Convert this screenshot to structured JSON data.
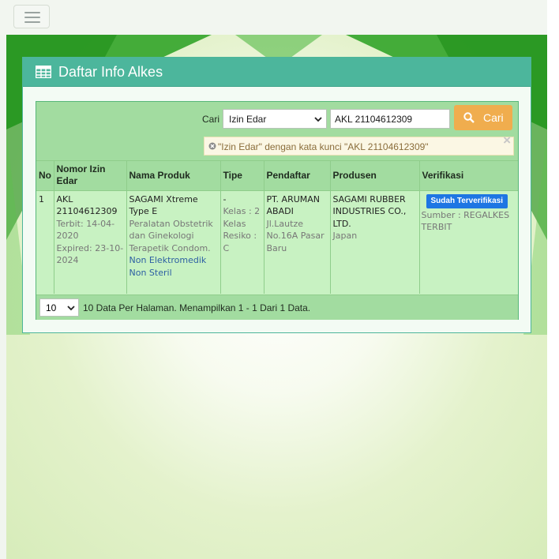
{
  "nav": {
    "menu_icon": "hamburger-icon"
  },
  "panel": {
    "title": "Daftar Info Alkes",
    "title_icon": "table-icon"
  },
  "search": {
    "label": "Cari",
    "field_selected": "Izin Edar",
    "query_value": "AKL 21104612309",
    "button_label": "Cari",
    "button_icon": "search-icon"
  },
  "alert": {
    "text": "\"Izin Edar\" dengan kata kunci \"AKL 21104612309\"",
    "close": "×"
  },
  "table": {
    "headers": [
      "No",
      "Nomor Izin Edar",
      "Nama Produk",
      "Tipe",
      "Pendaftar",
      "Produsen",
      "Verifikasi"
    ],
    "rows": [
      {
        "no": "1",
        "nomor": "AKL 21104612309",
        "terbit": "Terbit: 14-04-2020",
        "expired": "Expired: 23-10-2024",
        "nama": "SAGAMI Xtreme Type E",
        "kategori": "Peralatan Obstetrik dan Ginekologi Terapetik Condom.",
        "jenis": "Non Elektromedik Non Steril",
        "tipe": "-",
        "kelas": "Kelas : 2",
        "kelas_resiko": "Kelas Resiko : C",
        "pendaftar": "PT. ARUMAN ABADI",
        "pendaftar_alamat": "Jl.Lautze No.16A Pasar Baru",
        "produsen": "SAGAMI RUBBER INDUSTRIES CO., LTD.",
        "negara": "Japan",
        "status": "Sudah Terverifikasi",
        "sumber": "Sumber : REGALKES TERBIT"
      }
    ]
  },
  "pagination": {
    "per_page": "10",
    "summary": "10 Data Per Halaman. Menampilkan 1 - 1 Dari 1 Data."
  },
  "colors": {
    "panel_header": "#4cb69c",
    "table_bg": "#c8f2c2",
    "header_bg": "#a2dca0",
    "search_button": "#f0ad4e",
    "badge": "#1e76e3"
  }
}
